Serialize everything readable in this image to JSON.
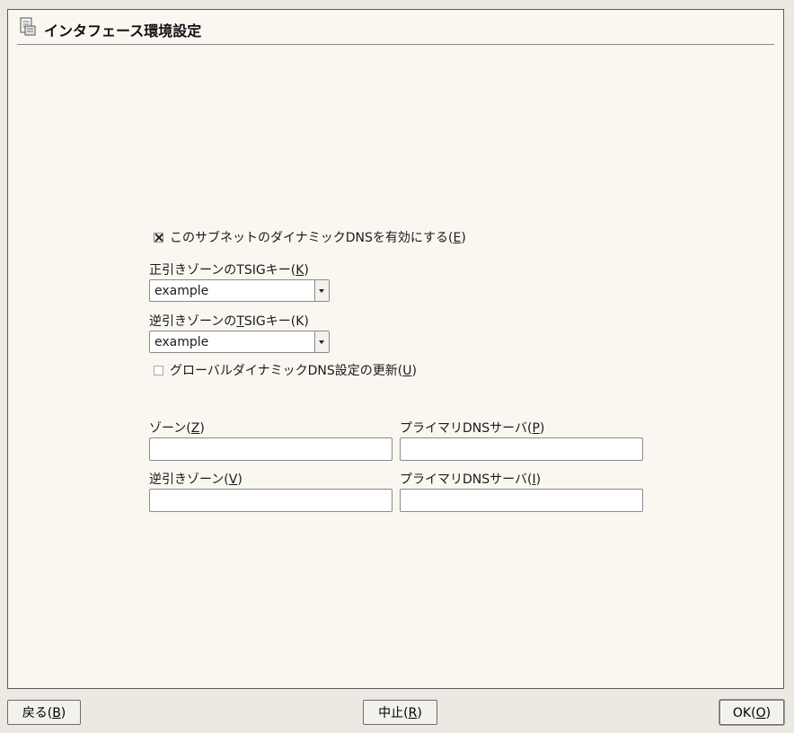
{
  "window": {
    "title": "インタフェース環境設定",
    "icon": "document-settings-icon"
  },
  "dynamic_dns": {
    "label_prefix": "このサブネットのダイナミックDNSを有効にする(",
    "mnemonic": "E",
    "label_suffix": ")",
    "checked": true
  },
  "forward_key": {
    "label_prefix": "正引きゾーンのTSIGキー(",
    "mnemonic": "K",
    "label_suffix": ")",
    "value": "example"
  },
  "reverse_key": {
    "label_prefix": "逆引きゾーンの",
    "mnemonic": "T",
    "label_suffix": "SIGキー(K)",
    "value": "example"
  },
  "global_update": {
    "label_prefix": "グローバルダイナミックDNS設定の更新(",
    "mnemonic": "U",
    "label_suffix": ")",
    "checked": false
  },
  "zone": {
    "label_prefix": "ゾーン(",
    "mnemonic": "Z",
    "label_suffix": ")",
    "value": ""
  },
  "primary_dns": {
    "label_prefix": "プライマリDNSサーバ(",
    "mnemonic": "P",
    "label_suffix": ")",
    "value": ""
  },
  "reverse_zone": {
    "label_prefix": "逆引きゾーン(",
    "mnemonic": "V",
    "label_suffix": ")",
    "value": ""
  },
  "reverse_primary_dns": {
    "label_prefix": "プライマリDNSサーバ(",
    "mnemonic": "I",
    "label_suffix": ")",
    "value": ""
  },
  "buttons": {
    "back": {
      "prefix": "戻る(",
      "mnemonic": "B",
      "suffix": ")"
    },
    "abort": {
      "prefix": "中止(",
      "mnemonic": "R",
      "suffix": ")"
    },
    "ok": {
      "prefix": "OK(",
      "mnemonic": "O",
      "suffix": ")"
    }
  }
}
